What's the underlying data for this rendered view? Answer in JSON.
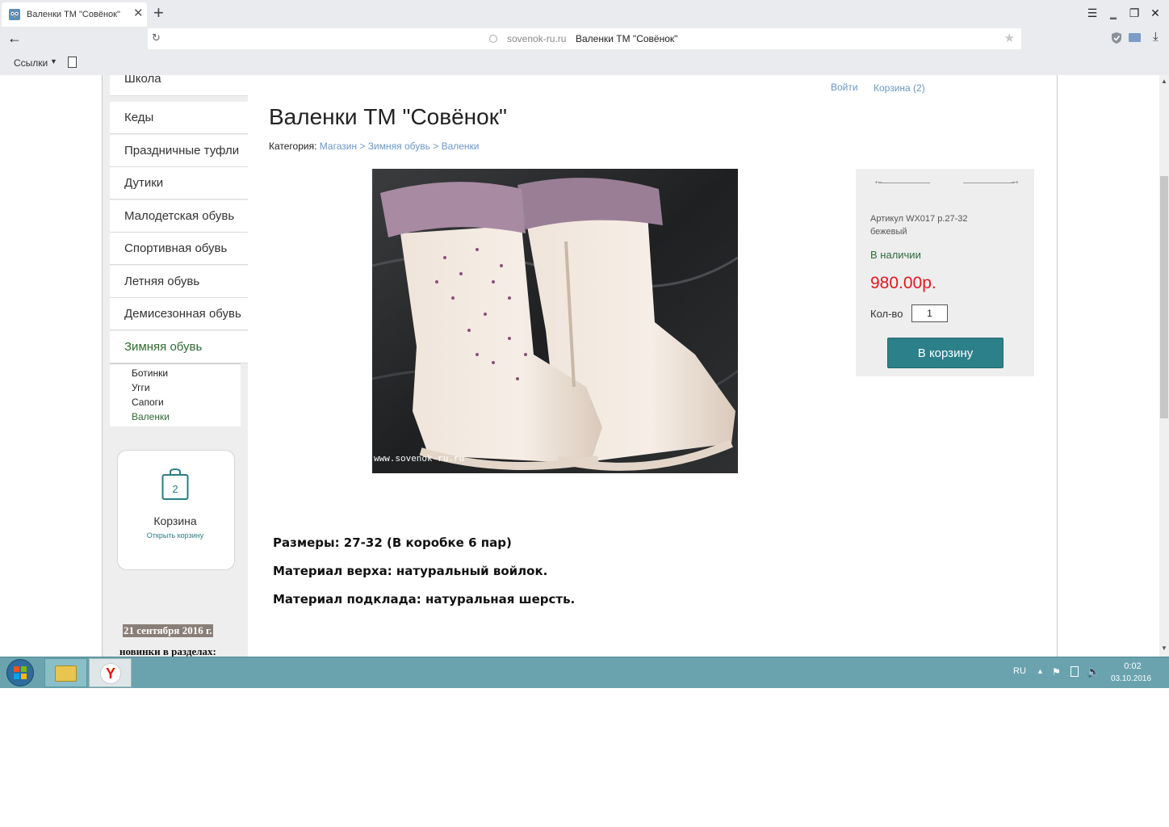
{
  "browser": {
    "tab_title": "Валенки ТМ \"Совёнок\"",
    "tab_close": "✕",
    "new_tab": "+",
    "window_controls": [
      "☰",
      "‗",
      "❐",
      "✕"
    ],
    "back": "←",
    "reload": "↻",
    "address_domain": "sovenok-ru.ru",
    "address_title": "Валенки ТМ \"Совёнок\"",
    "bookmark_star": "★",
    "download": "⤓",
    "bookmarks_bar": {
      "links_label": "Ссылки",
      "caret": "▼"
    }
  },
  "header": {
    "login": "Войти",
    "cart": "Корзина (2)"
  },
  "sidebar": {
    "items": [
      {
        "label": "Школа"
      },
      {
        "label": "Кеды"
      },
      {
        "label": "Праздничные туфли"
      },
      {
        "label": "Дутики"
      },
      {
        "label": "Малодетская обувь"
      },
      {
        "label": "Спортивная обувь"
      },
      {
        "label": "Летняя обувь"
      },
      {
        "label": "Демисезонная обувь"
      },
      {
        "label": "Зимняя обувь"
      }
    ],
    "subitems": [
      {
        "label": "Ботинки"
      },
      {
        "label": "Угги"
      },
      {
        "label": "Сапоги"
      },
      {
        "label": "Валенки"
      }
    ],
    "cart_widget": {
      "count": "2",
      "title": "Корзина",
      "open_link": "Открыть корзину"
    },
    "news": {
      "date": "21 сентября 2016 г.",
      "text": "новинки в разделах:"
    }
  },
  "product": {
    "title": "Валенки ТМ \"Совёнок\"",
    "category_label": "Категория:",
    "breadcrumb": [
      "Магазин",
      "Зимняя обувь",
      "Валенки"
    ],
    "breadcrumb_sep": ">",
    "image_watermark": "www.sovenok-ru.ru",
    "sku_line1": "Артикул WX017 р.27-32",
    "sku_line2": "бежевый",
    "stock": "В наличии",
    "price": "980.00р.",
    "qty_label": "Кол-во",
    "qty_value": "1",
    "add_to_cart": "В корзину",
    "description": [
      "Размеры: 27-32 (В коробке 6 пар)",
      "Материал верха: натуральный войлок.",
      "Материал подклада: натуральная шерсть."
    ]
  },
  "taskbar": {
    "yandex_letter": "Y",
    "tray_lang": "RU",
    "tray_caret": "▲",
    "tray_flag": "⚑",
    "tray_volume": "🔈",
    "time": "0:02",
    "date": "03.10.2016"
  },
  "colors": {
    "accent_teal": "#2c8089",
    "link_blue": "#6a97c6",
    "price_red": "#e5171f",
    "stock_green": "#2e6b3a",
    "taskbar": "#6aa3ae"
  }
}
